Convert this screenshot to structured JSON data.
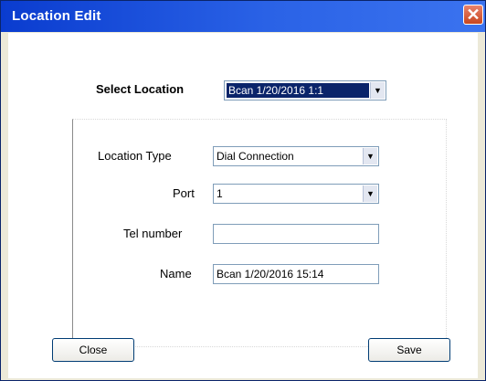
{
  "window": {
    "title": "Location Edit",
    "close_glyph": "✕"
  },
  "select_location": {
    "label": "Select Location",
    "value": "Bcan 1/20/2016 1:1",
    "arrow": "▼"
  },
  "form": {
    "location_type": {
      "label": "Location Type",
      "value": "Dial Connection",
      "arrow": "▼"
    },
    "port": {
      "label": "Port",
      "value": "1",
      "arrow": "▼"
    },
    "tel_number": {
      "label": "Tel number",
      "value": ""
    },
    "name": {
      "label": "Name",
      "value": "Bcan 1/20/2016 15:14"
    }
  },
  "buttons": {
    "close": "Close",
    "save": "Save"
  },
  "colors": {
    "titlebar": "#0a3ccf",
    "selection": "#0a246a",
    "field_border": "#7f9db9"
  }
}
